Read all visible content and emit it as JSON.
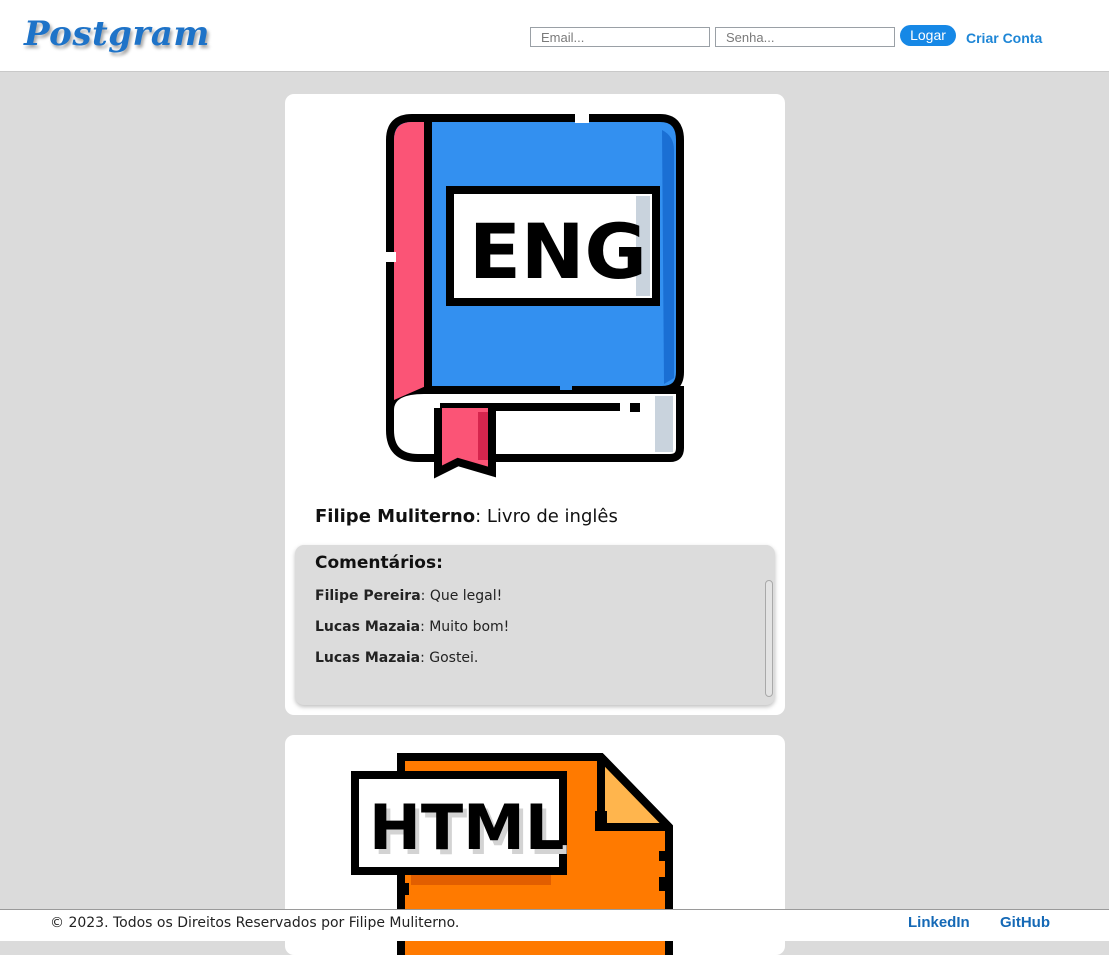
{
  "app": {
    "logo": "Postgram"
  },
  "header": {
    "email_placeholder": "Email...",
    "senha_placeholder": "Senha...",
    "login_label": "Logar",
    "create_account_label": "Criar Conta"
  },
  "posts": [
    {
      "image_icon": "eng-book-icon",
      "author": "Filipe Muliterno",
      "text": ": Livro de inglês",
      "image_text": "ENG",
      "comments_title": "Comentários:",
      "comments": [
        {
          "author": "Filipe Pereira",
          "text": ": Que legal!"
        },
        {
          "author": "Lucas Mazaia",
          "text": ": Muito bom!"
        },
        {
          "author": "Lucas Mazaia",
          "text": ": Gostei."
        }
      ]
    },
    {
      "image_icon": "html-file-icon",
      "image_text": "HTML"
    }
  ],
  "footer": {
    "copyright": "© 2023. Todos os Direitos Reservados por Filipe Muliterno.",
    "linkedin_label": "LinkedIn",
    "github_label": "GitHub"
  },
  "colors": {
    "accent": "#1688e6",
    "book_blue": "#3390f0",
    "book_red": "#fb5476",
    "file_orange": "#ff7a00"
  }
}
